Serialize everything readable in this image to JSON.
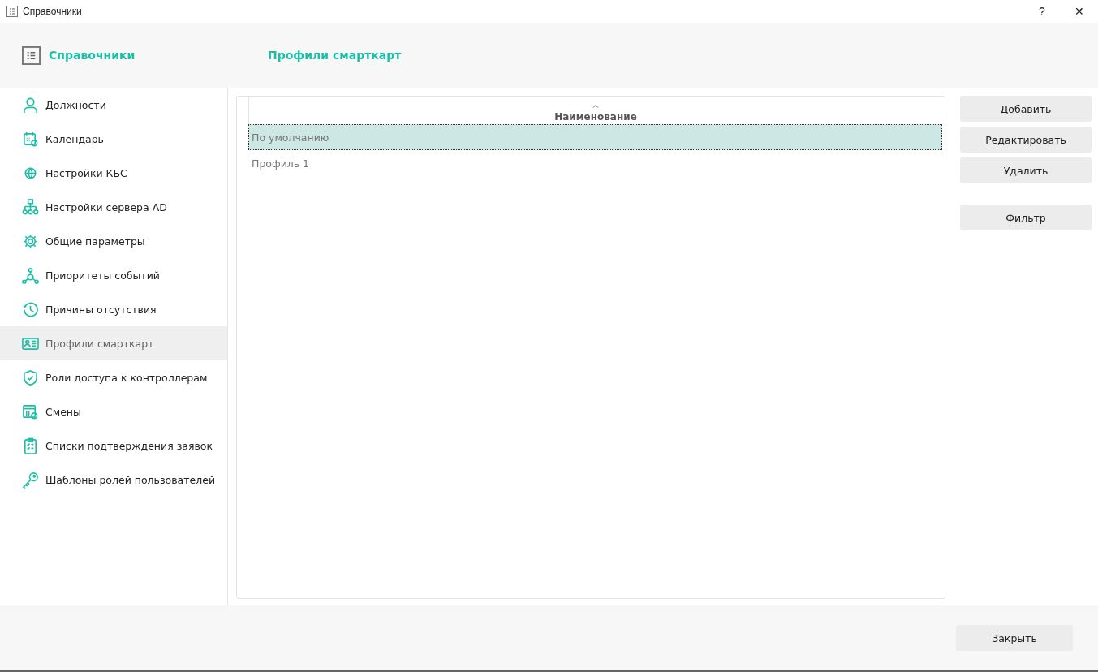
{
  "window": {
    "title": "Справочники",
    "help": "?",
    "close": "✕"
  },
  "header": {
    "title": "Справочники",
    "section": "Профили смарткарт"
  },
  "sidebar": {
    "items": [
      {
        "label": "Должности",
        "kind": "person",
        "selected": false
      },
      {
        "label": "Календарь",
        "kind": "calendar",
        "selected": false
      },
      {
        "label": "Настройки КБС",
        "kind": "globe",
        "selected": false
      },
      {
        "label": "Настройки сервера AD",
        "kind": "network",
        "selected": false
      },
      {
        "label": "Общие параметры",
        "kind": "gear",
        "selected": false
      },
      {
        "label": "Приоритеты событий",
        "kind": "nodes",
        "selected": false
      },
      {
        "label": "Причины отсутствия",
        "kind": "clock",
        "selected": false
      },
      {
        "label": "Профили смарткарт",
        "kind": "card",
        "selected": true
      },
      {
        "label": "Роли доступа к контроллерам",
        "kind": "shield",
        "selected": false
      },
      {
        "label": "Смены",
        "kind": "shifts",
        "selected": false
      },
      {
        "label": "Списки подтверждения заявок",
        "kind": "clipboard",
        "selected": false
      },
      {
        "label": "Шаблоны ролей пользователей",
        "kind": "key",
        "selected": false
      }
    ]
  },
  "table": {
    "columns": [
      "Наименование"
    ],
    "rows": [
      {
        "name": "По умолчанию",
        "selected": true
      },
      {
        "name": "Профиль 1",
        "selected": false
      }
    ]
  },
  "actions": [
    "Добавить",
    "Редактировать",
    "Удалить"
  ],
  "filter": "Фильтр",
  "footer": {
    "close": "Закрыть"
  }
}
